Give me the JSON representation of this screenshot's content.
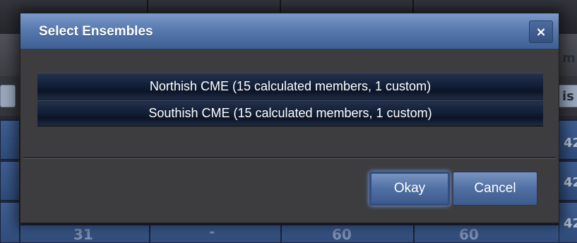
{
  "dialog": {
    "title": "Select Ensembles",
    "close_label": "×",
    "ensembles": [
      "Northish CME (15 calculated members, 1 custom)",
      "Southish CME (15 calculated members, 1 custom)"
    ],
    "okay_label": "Okay",
    "cancel_label": "Cancel"
  },
  "background": {
    "header_edge_text": "m",
    "filter_edge_text": "is",
    "row_edge_values": [
      "42",
      "42",
      "42"
    ],
    "bottom_row_values": [
      "31",
      "-",
      "60",
      "60"
    ]
  },
  "colors": {
    "titlebar_accent": "#587aaf",
    "dialog_body": "#3d3d3f",
    "list_item": "#13203a",
    "button": "#506fa3",
    "grid_cell": "#3f5f93"
  }
}
